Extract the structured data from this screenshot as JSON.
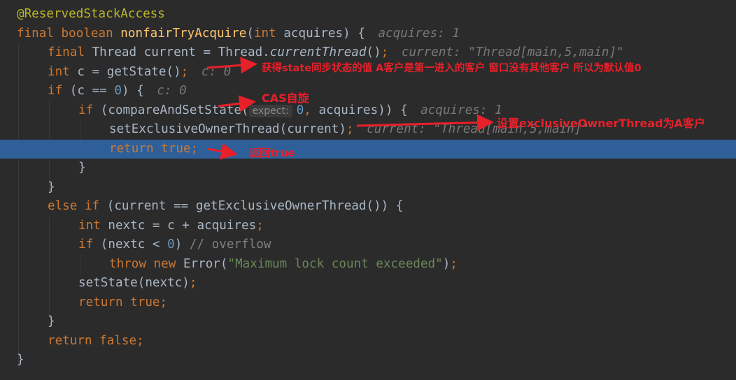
{
  "editor": {
    "highlighted_line": 7,
    "colors": {
      "background": "#2b2b2b",
      "execution_line": "#2e5f99",
      "annotation_red": "#e8202a"
    },
    "lines": [
      {
        "indent": 0,
        "tokens": [
          [
            "@ReservedStackAccess",
            "an"
          ]
        ]
      },
      {
        "indent": 0,
        "tokens": [
          [
            "final boolean ",
            "kw"
          ],
          [
            "nonfairTryAcquire",
            "fn"
          ],
          [
            "(",
            ""
          ],
          [
            "int ",
            "kw"
          ],
          [
            "acquires) {",
            ""
          ]
        ],
        "hint": "acquires: 1"
      },
      {
        "indent": 1,
        "tokens": [
          [
            "final ",
            "kw"
          ],
          [
            "Thread current = Thread.",
            ""
          ],
          [
            "currentThread",
            "it"
          ],
          [
            "()",
            ""
          ],
          [
            ";",
            "kw"
          ]
        ],
        "hint": "current: \"Thread[main,5,main]\""
      },
      {
        "indent": 1,
        "tokens": [
          [
            "int ",
            "kw"
          ],
          [
            "c = getState()",
            ""
          ],
          [
            ";",
            "kw"
          ]
        ],
        "hint": "c: 0"
      },
      {
        "indent": 1,
        "tokens": [
          [
            "if ",
            "kw"
          ],
          [
            "(c == ",
            ""
          ],
          [
            "0",
            "num"
          ],
          [
            ") {",
            ""
          ]
        ],
        "hint": "c: 0"
      },
      {
        "indent": 2,
        "tokens": [
          [
            "if ",
            "kw"
          ],
          [
            "(compareAndSetState(",
            ""
          ],
          [
            "expect:",
            "param"
          ],
          [
            "0",
            "num"
          ],
          [
            ", ",
            "kw"
          ],
          [
            "acquires)) {",
            ""
          ]
        ],
        "hint": "acquires: 1"
      },
      {
        "indent": 3,
        "tokens": [
          [
            "setExclusiveOwnerThread(current)",
            ""
          ],
          [
            ";",
            "kw"
          ]
        ],
        "hint": "current: \"Thread[main,5,main]\""
      },
      {
        "indent": 3,
        "tokens": [
          [
            "return true",
            "kw"
          ],
          [
            ";",
            "kw"
          ]
        ]
      },
      {
        "indent": 2,
        "tokens": [
          [
            "}",
            ""
          ]
        ]
      },
      {
        "indent": 1,
        "tokens": [
          [
            "}",
            ""
          ]
        ]
      },
      {
        "indent": 1,
        "tokens": [
          [
            "else if ",
            "kw"
          ],
          [
            "(current == getExclusiveOwnerThread()) {",
            ""
          ]
        ]
      },
      {
        "indent": 2,
        "tokens": [
          [
            "int ",
            "kw"
          ],
          [
            "nextc = c + acquires",
            ""
          ],
          [
            ";",
            "kw"
          ]
        ]
      },
      {
        "indent": 2,
        "tokens": [
          [
            "if ",
            "kw"
          ],
          [
            "(nextc < ",
            ""
          ],
          [
            "0",
            "num"
          ],
          [
            ") ",
            ""
          ],
          [
            "// overflow",
            "cm"
          ]
        ]
      },
      {
        "indent": 3,
        "tokens": [
          [
            "throw new ",
            "kw"
          ],
          [
            "Error(",
            ""
          ],
          [
            "\"Maximum lock count exceeded\"",
            "str"
          ],
          [
            ")",
            ""
          ],
          [
            ";",
            "kw"
          ]
        ]
      },
      {
        "indent": 2,
        "tokens": [
          [
            "setState(nextc)",
            ""
          ],
          [
            ";",
            "kw"
          ]
        ]
      },
      {
        "indent": 2,
        "tokens": [
          [
            "return true",
            "kw"
          ],
          [
            ";",
            "kw"
          ]
        ]
      },
      {
        "indent": 1,
        "tokens": [
          [
            "}",
            ""
          ]
        ]
      },
      {
        "indent": 1,
        "tokens": [
          [
            "return false",
            "kw"
          ],
          [
            ";",
            "kw"
          ]
        ]
      },
      {
        "indent": 0,
        "tokens": [
          [
            "}",
            ""
          ]
        ]
      }
    ]
  },
  "annotations": {
    "state_note": "获得state同步状态的值 A客户是第一进入的客户  窗口没有其他客户  所以为默认值0",
    "cas_note": "CAS自旋",
    "owner_note": "设置exclusiveOwnerThread为A客户",
    "return_note": "返回true"
  }
}
